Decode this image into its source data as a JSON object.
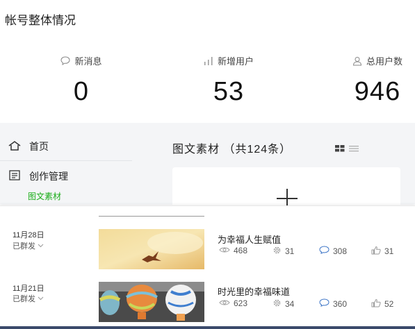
{
  "overview": {
    "title": "帐号整体情况",
    "stats": [
      {
        "label": "新消息",
        "value": "0",
        "icon": "chat-bubble-icon"
      },
      {
        "label": "新增用户",
        "value": "53",
        "icon": "bar-chart-icon"
      },
      {
        "label": "总用户数",
        "value": "946",
        "icon": "user-icon"
      }
    ]
  },
  "sidebar": {
    "home_label": "首页",
    "create_label": "创作管理",
    "sub_active_label": "图文素材"
  },
  "content": {
    "title": "图文素材 （共124条）",
    "add_icon": "plus-icon",
    "view_icons": [
      "grid-view-icon",
      "list-view-icon"
    ]
  },
  "articles": [
    {
      "date": "11月28日",
      "status": "已群发",
      "title": "为幸福人生赋值",
      "views": "468",
      "shares": "31",
      "comments": "308",
      "likes": "31"
    },
    {
      "date": "11月21日",
      "status": "已群发",
      "title": "时光里的幸福味道",
      "views": "623",
      "shares": "34",
      "comments": "360",
      "likes": "52"
    }
  ],
  "colors": {
    "accent": "#1aad19",
    "panel_bg": "#f4f5f7",
    "bottom_bar": "#3b4a6b"
  }
}
